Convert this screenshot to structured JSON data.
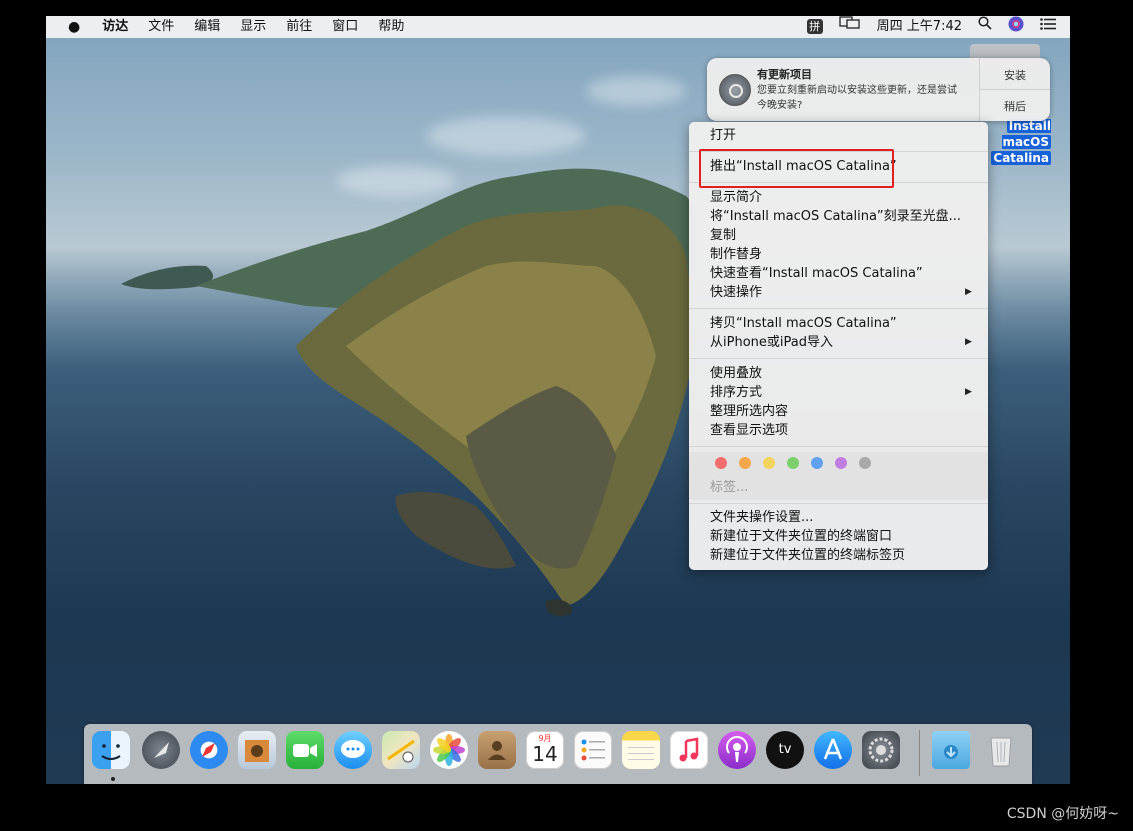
{
  "menubar": {
    "app_name": "访达",
    "items": [
      "文件",
      "编辑",
      "显示",
      "前往",
      "窗口",
      "帮助"
    ],
    "input_method": "拼",
    "clock": "周四 上午7:42"
  },
  "notification": {
    "title": "有更新项目",
    "body": "您要立刻重新启动以安装这些更新，还是尝试今晚安装?",
    "action_install": "安装",
    "action_later": "稍后"
  },
  "desktop_icon": {
    "label_line1": "Install macOS",
    "label_line2": "Catalina"
  },
  "context_menu": {
    "open": "打开",
    "eject": "推出“Install macOS Catalina”",
    "get_info": "显示简介",
    "burn": "将“Install macOS Catalina”刻录至光盘...",
    "duplicate": "复制",
    "make_alias": "制作替身",
    "quick_look": "快速查看“Install macOS Catalina”",
    "quick_actions": "快速操作",
    "copy": "拷贝“Install macOS Catalina”",
    "import_from_iphone": "从iPhone或iPad导入",
    "use_stacks": "使用叠放",
    "sort_by": "排序方式",
    "clean_up_selection": "整理所选内容",
    "view_options": "查看显示选项",
    "tags_placeholder": "标签...",
    "tag_colors": [
      "#f26d6d",
      "#f5a64a",
      "#f2d45c",
      "#7cd06a",
      "#5fa0f0",
      "#c07ce0",
      "#a8a8a8"
    ],
    "folder_actions_setup": "文件夹操作设置...",
    "new_terminal_at_folder": "新建位于文件夹位置的终端窗口",
    "new_terminal_tab_at_folder": "新建位于文件夹位置的终端标签页",
    "submenu_arrow": "▶"
  },
  "dock": {
    "calendar_month": "9月",
    "calendar_day": "14",
    "tv_label": "tv",
    "items": [
      "finder-icon",
      "launchpad-icon",
      "safari-icon",
      "mail-icon",
      "facetime-icon",
      "messages-icon",
      "maps-icon",
      "photos-icon",
      "contacts-icon",
      "calendar-icon",
      "reminders-icon",
      "notes-icon",
      "music-icon",
      "podcasts-icon",
      "apple-tv-icon",
      "app-store-icon",
      "system-preferences-icon",
      "downloads-folder-icon",
      "trash-icon"
    ]
  },
  "watermark": "CSDN @何妨呀~"
}
